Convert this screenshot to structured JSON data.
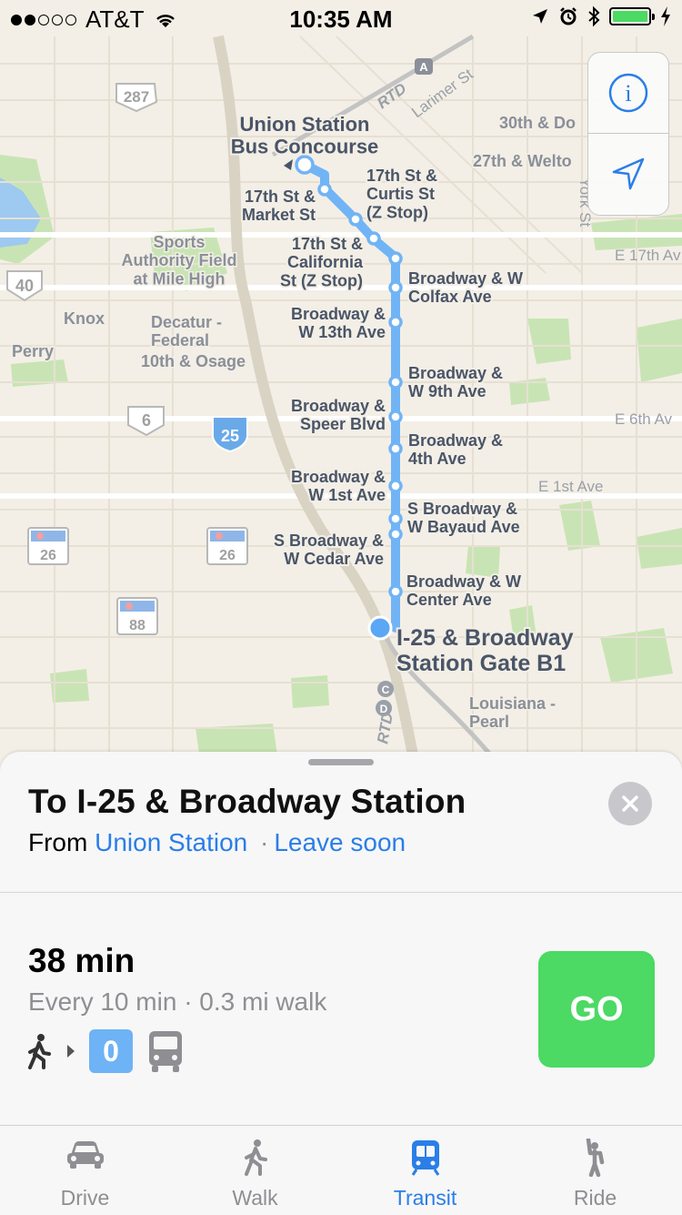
{
  "status_bar": {
    "carrier": "AT&T",
    "time": "10:35 AM",
    "signal_bars_filled": 2,
    "signal_bars_total": 5,
    "battery_level_percent": 100,
    "icons": [
      "wifi-icon",
      "location-arrow-icon",
      "alarm-icon",
      "bluetooth-icon",
      "battery-icon",
      "charging-bolt-icon"
    ]
  },
  "map": {
    "colors": {
      "land": "#f3efe6",
      "park": "#c9e4b4",
      "water": "#9ec9f0",
      "route": "#71b4f6",
      "label": "#4a5568"
    },
    "route_labels": {
      "origin": "Union Station\nBus Concourse",
      "s1": "17th St &\nMarket St",
      "s2": "17th St &\nCurtis St\n(Z Stop)",
      "s3": "17th St &\nCalifornia\nSt (Z Stop)",
      "s4": "Broadway & W\nColfax Ave",
      "s5": "Broadway &\nW 13th Ave",
      "s6": "Broadway &\nW 9th Ave",
      "s7": "Broadway &\nSpeer Blvd",
      "s8": "Broadway &\n4th Ave",
      "s9": "Broadway &\nW 1st Ave",
      "s10": "S Broadway &\nW Bayaud Ave",
      "s11": "S Broadway &\nW Cedar Ave",
      "s12": "Broadway & W\nCenter Ave",
      "destination": "I-25 & Broadway\nStation Gate B1"
    },
    "place_labels": {
      "sports": "Sports\nAuthority Field\nat Mile High",
      "knox": "Knox",
      "perry": "Perry",
      "decatur": "Decatur -\nFederal",
      "osage": "10th & Osage",
      "louisiana": "Louisiana -\nPearl",
      "larimer": "Larimer St",
      "rtd_top": "RTD",
      "rtd_bottom": "RTD",
      "st30": "30th & Do",
      "st27": "27th & Welto",
      "york": "York St",
      "e17": "E 17th Av",
      "e6": "E 6th Av",
      "e1": "E 1st Ave"
    },
    "shields": {
      "us287": "287",
      "us40": "40",
      "us6": "6",
      "i25": "25",
      "co26a": "26",
      "co26b": "26",
      "co88": "88"
    },
    "line_markers": {
      "a": "A",
      "c": "C",
      "d": "D"
    }
  },
  "map_controls": {
    "info_icon": "info-icon",
    "location_icon": "location-arrow-icon",
    "info_glyph": "i"
  },
  "directions": {
    "title": "To I-25 & Broadway Station",
    "from_label": "From",
    "from_place": "Union Station",
    "separator": "·",
    "leave": "Leave soon",
    "route": {
      "duration": "38 min",
      "frequency": "Every 10 min",
      "walk": "0.3 mi walk",
      "line": "0",
      "go_label": "GO"
    }
  },
  "tabs": [
    {
      "label": "Drive",
      "icon": "car-icon",
      "active": false
    },
    {
      "label": "Walk",
      "icon": "walk-icon",
      "active": false
    },
    {
      "label": "Transit",
      "icon": "transit-icon",
      "active": true
    },
    {
      "label": "Ride",
      "icon": "ride-hail-icon",
      "active": false
    }
  ]
}
